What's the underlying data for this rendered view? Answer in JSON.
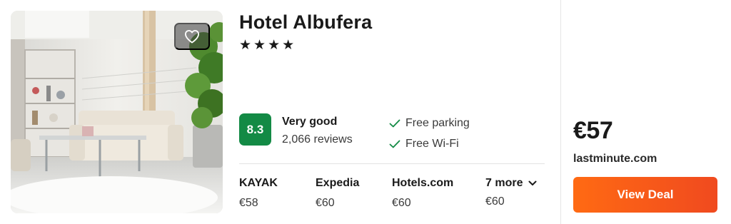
{
  "hotel": {
    "name": "Hotel Albufera",
    "stars": "★★★★",
    "star_count": 4
  },
  "rating": {
    "score": "8.3",
    "label": "Very good",
    "reviews": "2,066 reviews",
    "color": "#138a45"
  },
  "amenities": [
    {
      "label": "Free parking",
      "icon": "check-icon"
    },
    {
      "label": "Free Wi-Fi",
      "icon": "check-icon"
    }
  ],
  "providers": [
    {
      "name": "KAYAK",
      "price": "€58"
    },
    {
      "name": "Expedia",
      "price": "€60"
    },
    {
      "name": "Hotels.com",
      "price": "€60"
    },
    {
      "name": "7 more",
      "price": "€60",
      "icon": "chevron-down-icon"
    }
  ],
  "deal": {
    "price": "€57",
    "site": "lastminute.com",
    "button_label": "View Deal",
    "accent": "#ff6a13"
  },
  "favorite": {
    "icon": "heart-icon"
  }
}
